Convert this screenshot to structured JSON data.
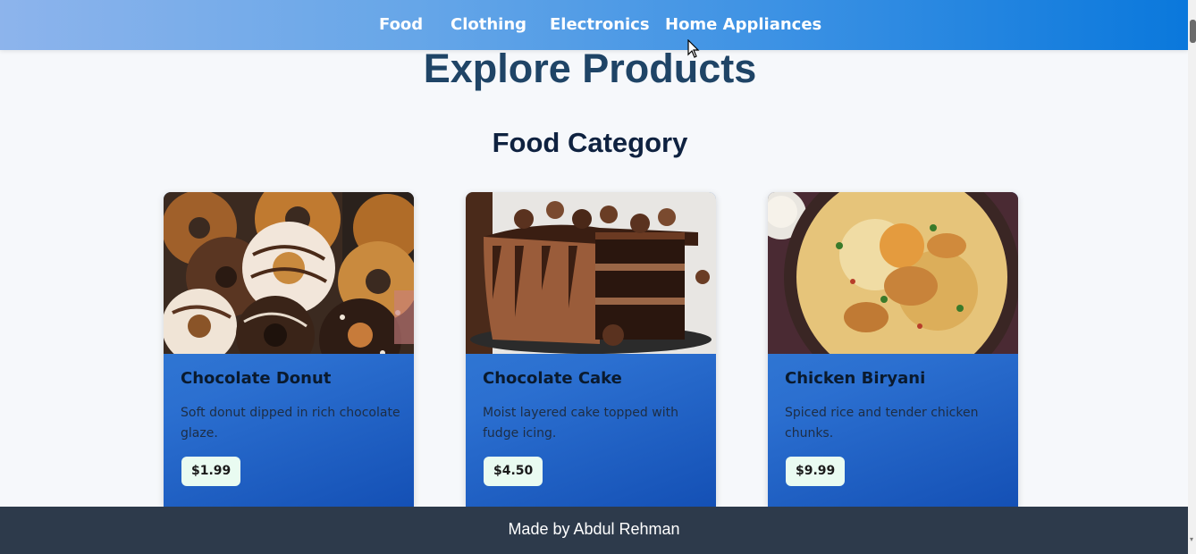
{
  "nav": {
    "links": [
      "Food",
      "Clothing",
      "Electronics",
      "Home Appliances"
    ]
  },
  "page_title": "Explore Products",
  "section_title": "Food Category",
  "products": [
    {
      "name": "Chocolate Donut",
      "description": "Soft donut dipped in rich chocolate glaze.",
      "price": "$1.99",
      "image": "donuts-image"
    },
    {
      "name": "Chocolate Cake",
      "description": "Moist layered cake topped with fudge icing.",
      "price": "$4.50",
      "image": "chocolate-cake-image"
    },
    {
      "name": "Chicken Biryani",
      "description": "Spiced rice and tender chicken chunks.",
      "price": "$9.99",
      "image": "biryani-image"
    }
  ],
  "footer": {
    "text": "Made by Abdul Rehman"
  },
  "colors": {
    "nav_start": "#8db4ec",
    "nav_end": "#0a78dc",
    "card_blue": "#2b6fd0",
    "footer_bg": "#2d3a4b",
    "title": "#1f4466"
  }
}
